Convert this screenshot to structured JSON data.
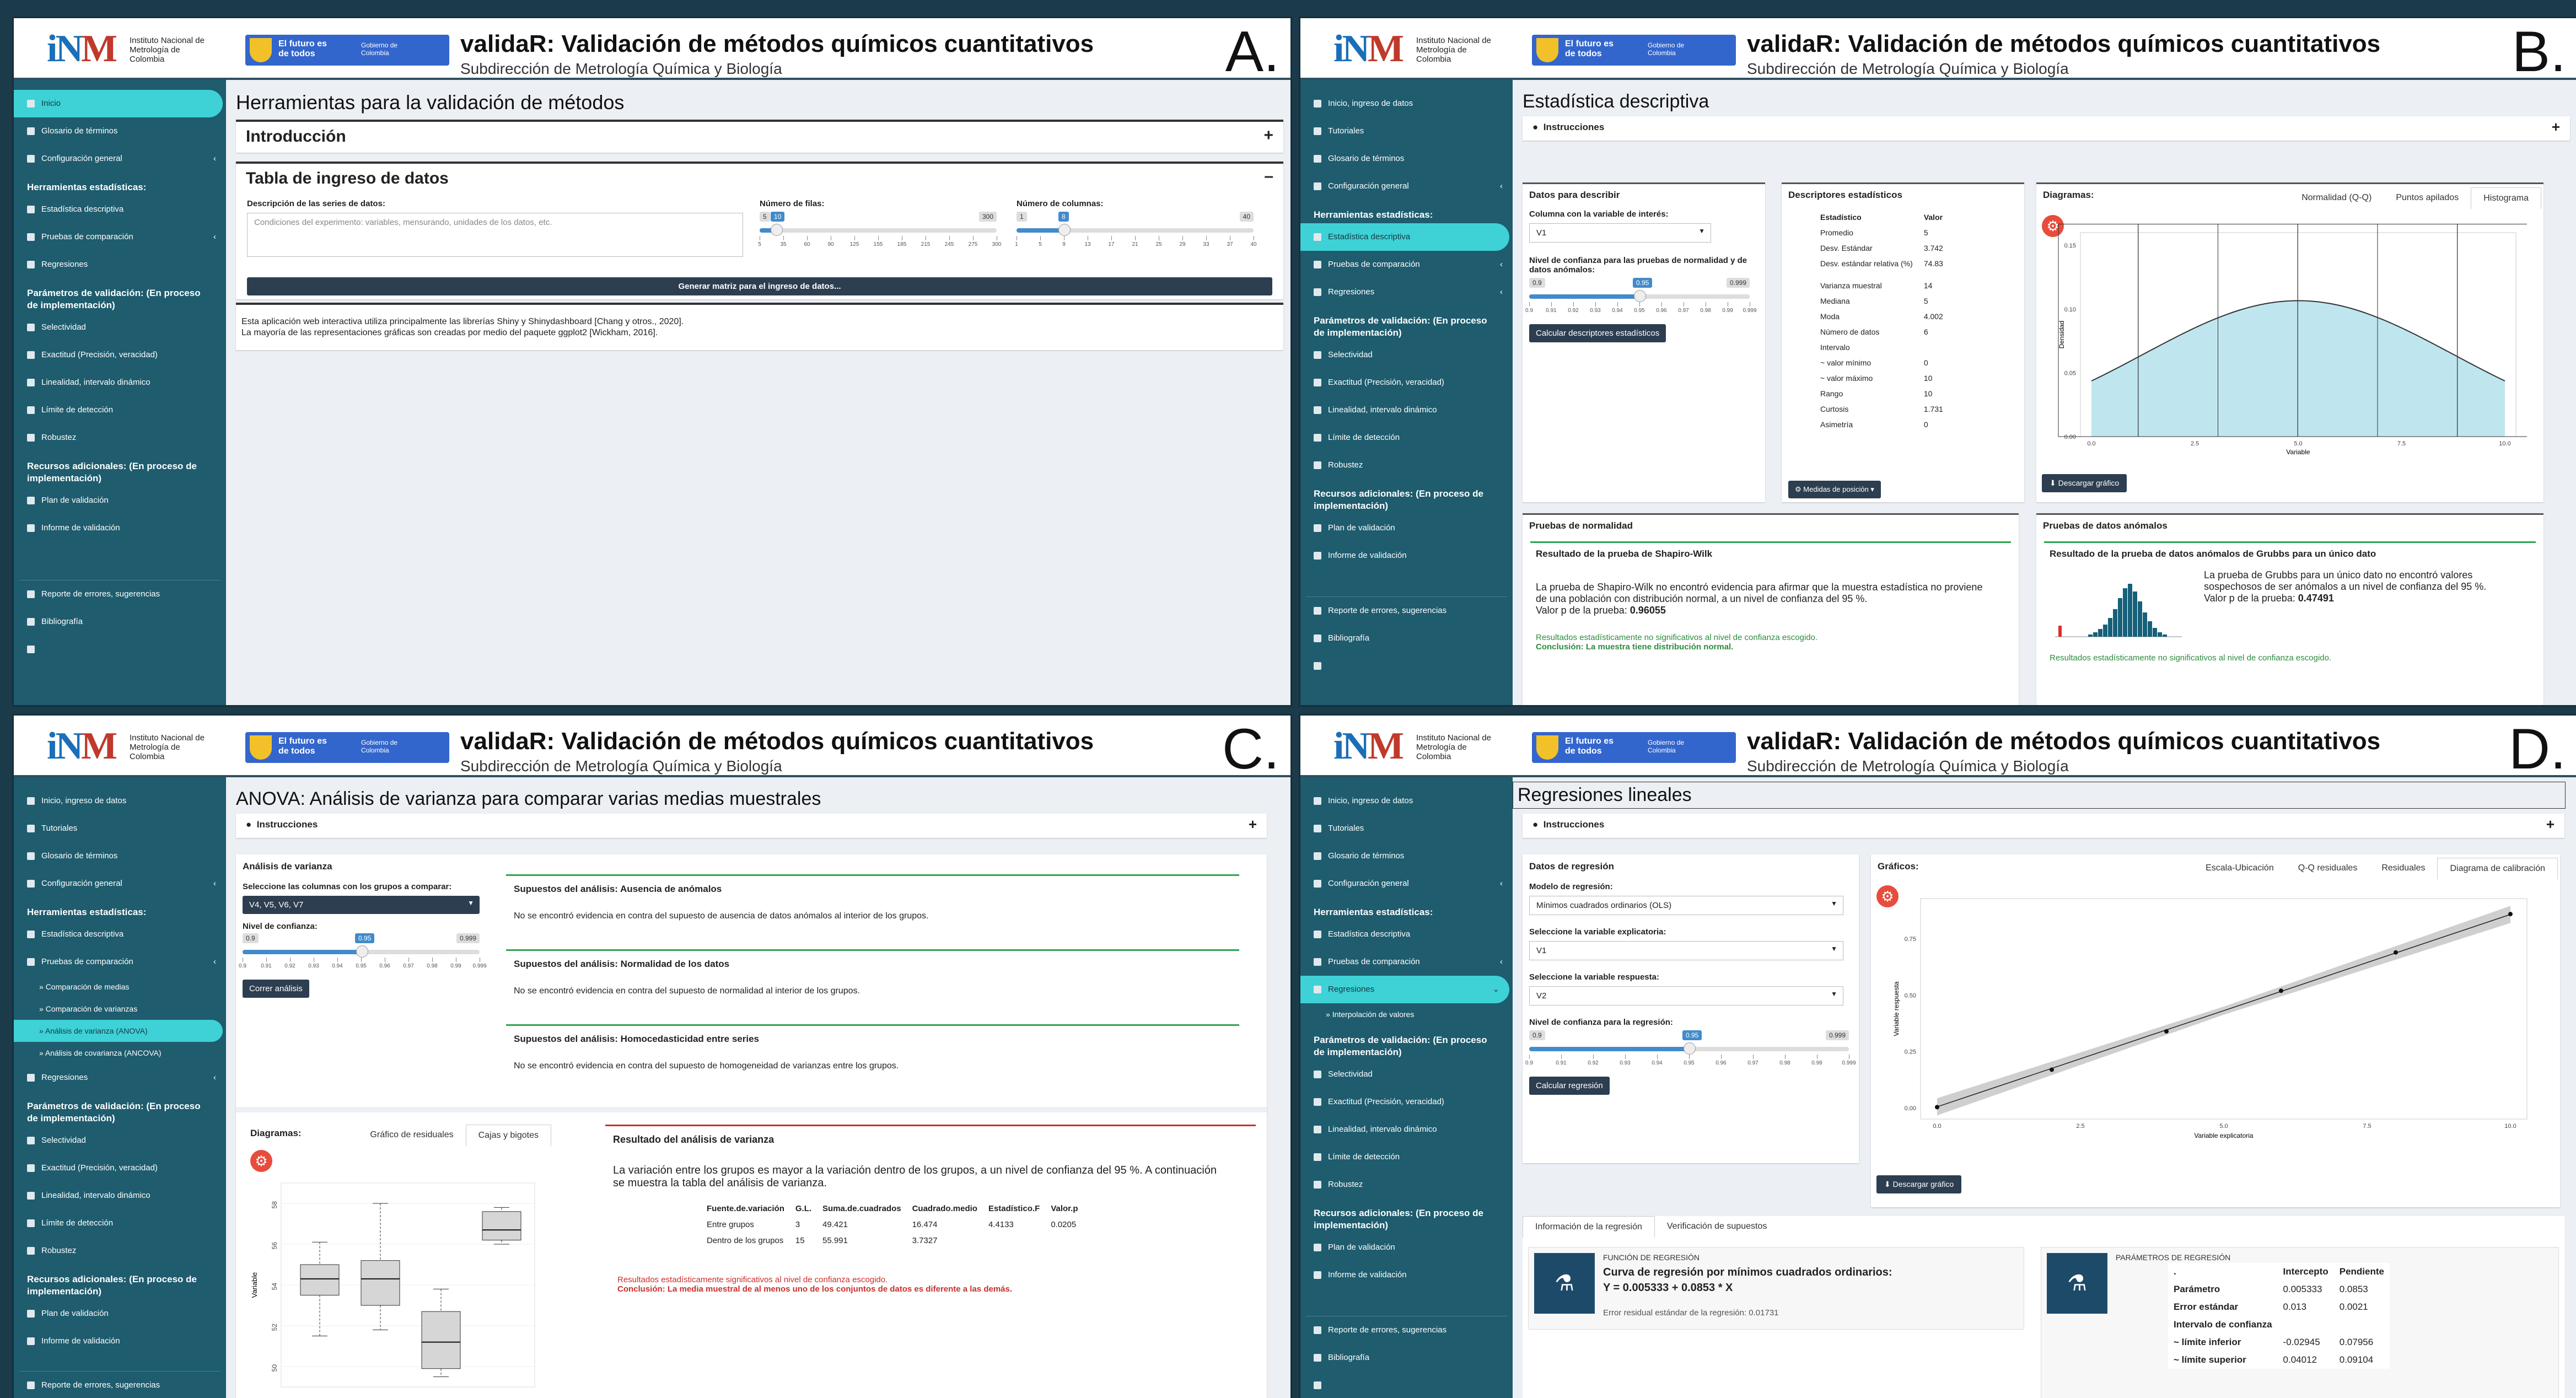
{
  "common": {
    "inm_logo_text": "Instituto Nacional de Metrología de Colombia",
    "gov_t1": "El futuro es de todos",
    "gov_t2": "Gobierno de Colombia",
    "app_title": "validaR: Validación de métodos químicos cuantitativos",
    "app_subtitle": "Subdirección de Metrología Química y Biología"
  },
  "panelA": {
    "letter": "A.",
    "sidebar": [
      {
        "label": "Inicio",
        "active": true
      },
      {
        "label": "Glosario de términos"
      },
      {
        "label": "Configuración general",
        "chev": "‹"
      }
    ],
    "head1": "Herramientas estadísticas:",
    "tools": [
      {
        "label": "Estadística descriptiva"
      },
      {
        "label": "Pruebas de comparación",
        "chev": "‹"
      },
      {
        "label": "Regresiones"
      }
    ],
    "head2": "Parámetros de validación: (En proceso de implementación)",
    "params": [
      {
        "label": "Selectividad"
      },
      {
        "label": "Exactitud (Precisión, veracidad)"
      },
      {
        "label": "Linealidad, intervalo dinámico"
      },
      {
        "label": "Límite de detección"
      },
      {
        "label": "Robustez"
      }
    ],
    "head3": "Recursos adicionales: (En proceso de implementación)",
    "resources": [
      {
        "label": "Plan de validación"
      },
      {
        "label": "Informe de validación"
      }
    ],
    "footer_items": [
      {
        "label": "Reporte de errores, sugerencias"
      },
      {
        "label": "Bibliografía"
      },
      {
        "label": ""
      }
    ],
    "page_title": "Herramientas para la validación de métodos",
    "intro_title": "Introducción",
    "table_title": "Tabla de ingreso de datos",
    "desc_label": "Descripción de las series de datos:",
    "desc_placeholder": "Condiciones del experimento: variables, mensurando, unidades de los datos, etc.",
    "rows_label": "Número de filas:",
    "rows_min": "5",
    "rows_val": "10",
    "rows_max": "300",
    "rows_ticks": [
      "5",
      "35",
      "60",
      "90",
      "125",
      "155",
      "185",
      "215",
      "245",
      "275",
      "300"
    ],
    "cols_label": "Número de columnas:",
    "cols_min": "1",
    "cols_val": "8",
    "cols_max": "40",
    "cols_ticks": [
      "1",
      "5",
      "9",
      "13",
      "17",
      "21",
      "25",
      "29",
      "33",
      "37",
      "40"
    ],
    "gen_button": "Generar matriz para el ingreso de datos...",
    "credits_1": "Esta aplicación web interactiva utiliza principalmente las librerías Shiny y Shinydashboard [Chang y otros., 2020].",
    "credits_2": "La mayoría de las representaciones gráficas son creadas por medio del paquete ggplot2 [Wickham, 2016]."
  },
  "panelB": {
    "letter": "B.",
    "sidebar_top": [
      {
        "label": "Inicio, ingreso de datos"
      },
      {
        "label": "Tutoriales"
      },
      {
        "label": "Glosario de términos"
      },
      {
        "label": "Configuración general",
        "chev": "‹"
      }
    ],
    "tools": [
      {
        "label": "Estadística descriptiva",
        "active": true
      },
      {
        "label": "Pruebas de comparación",
        "chev": "‹"
      },
      {
        "label": "Regresiones",
        "chev": "‹"
      }
    ],
    "page_title": "Estadística descriptiva",
    "instr": "Instrucciones",
    "data_box_title": "Datos para describir",
    "col_label": "Columna con la variable de interés:",
    "col_value": "V1",
    "conf_label": "Nivel de confianza para las pruebas de normalidad y de datos anómalos:",
    "conf_min": "0.9",
    "conf_val": "0.95",
    "conf_max": "0.999",
    "conf_ticks": [
      "0.9",
      "0.91",
      "0.92",
      "0.93",
      "0.94",
      "0.95",
      "0.96",
      "0.97",
      "0.98",
      "0.99",
      "0.999"
    ],
    "calc_button": "Calcular descriptores estadísticos",
    "desc_box_title": "Descriptores estadísticos",
    "desc_head": [
      "Estadístico",
      "Valor"
    ],
    "desc_rows": [
      [
        "Promedio",
        "5"
      ],
      [
        "Desv. Estándar",
        "3.742"
      ],
      [
        "Desv. estándar relativa (%)",
        "74.83"
      ],
      [
        "",
        ""
      ],
      [
        "Varianza muestral",
        "14"
      ],
      [
        "Mediana",
        "5"
      ],
      [
        "Moda",
        "4.002"
      ],
      [
        "Número de datos",
        "6"
      ],
      [
        "Intervalo",
        ""
      ],
      [
        "~ valor mínimo",
        "0"
      ],
      [
        "~ valor máximo",
        "10"
      ],
      [
        "Rango",
        "10"
      ],
      [
        "Curtosis",
        "1.731"
      ],
      [
        "Asimetría",
        "0"
      ]
    ],
    "measures_btn": "Medidas de posición",
    "diag_title": "Diagramas:",
    "diag_tabs": [
      "Normalidad (Q-Q)",
      "Puntos apilados",
      "Histograma"
    ],
    "yaxis_label": "Densidad",
    "xaxis_label": "Variable",
    "hist_y_ticks": [
      "0.00",
      "0.05",
      "0.10",
      "0.15"
    ],
    "hist_x_ticks": [
      "0.0",
      "2.5",
      "5.0",
      "7.5",
      "10.0"
    ],
    "download_btn": "Descargar gráfico",
    "norm_title": "Pruebas de normalidad",
    "sw_title": "Resultado de la prueba de Shapiro-Wilk",
    "sw_text": "La prueba de Shapiro-Wilk no encontró evidencia para afirmar que la muestra estadística no proviene de una población con distribución normal, a un nivel de confianza del 95 %.",
    "sw_p_label": "Valor p de la prueba:",
    "sw_p": "0.96055",
    "sw_green": "Resultados estadísticamente no significativos al nivel de confianza escogido.",
    "sw_concl": "Conclusión: La muestra tiene distribución normal.",
    "outlier_title": "Pruebas de datos anómalos",
    "grubbs_title": "Resultado de la prueba de datos anómalos de Grubbs para un único dato",
    "grubbs_text": "La prueba de Grubbs para un único dato no encontró valores sospechosos de ser anómalos a un nivel de confianza del 95 %.",
    "grubbs_p_label": "Valor p de la prueba:",
    "grubbs_p": "0.47491",
    "grubbs_green": "Resultados estadísticamente no significativos al nivel de confianza escogido."
  },
  "panelC": {
    "letter": "C.",
    "comp_sub": [
      {
        "label": "Comparación de medias"
      },
      {
        "label": "Comparación de varianzas"
      },
      {
        "label": "Análisis de varianza (ANOVA)",
        "active": true
      },
      {
        "label": "Análisis de covarianza (ANCOVA)"
      }
    ],
    "page_title": "ANOVA: Análisis de varianza para comparar varias medias muestrales",
    "box_title": "Análisis de varianza",
    "cols_label": "Seleccione las columnas con los grupos a comparar:",
    "cols_value": "V4, V5, V6, V7",
    "conf_label": "Nivel de confianza:",
    "run_button": "Correr análisis",
    "sup1_title": "Supuestos del análisis: Ausencia de anómalos",
    "sup1_text": "No se encontró evidencia en contra del supuesto de ausencia de datos anómalos al interior de los grupos.",
    "sup2_title": "Supuestos del análisis: Normalidad de los datos",
    "sup2_text": "No se encontró evidencia en contra del supuesto de normalidad al interior de los grupos.",
    "sup3_title": "Supuestos del análisis: Homocedasticidad entre series",
    "sup3_text": "No se encontró evidencia en contra del supuesto de homogeneidad de varianzas entre los grupos.",
    "diag_title": "Diagramas:",
    "diag_tabs": [
      "Gráfico de residuales",
      "Cajas y bigotes"
    ],
    "box_y_ticks": [
      "50",
      "52",
      "54",
      "56",
      "58"
    ],
    "box_ylabel": "Variable",
    "res_title": "Resultado del análisis de varianza",
    "res_text": "La variación entre los grupos es mayor a la variación dentro de los grupos, a un nivel de confianza del 95 %. A continuación se muestra la tabla del análisis de varianza.",
    "anova_head": [
      "Fuente.de.variación",
      "G.L.",
      "Suma.de.cuadrados",
      "Cuadrado.medio",
      "Estadístico.F",
      "Valor.p"
    ],
    "anova_rows": [
      [
        "Entre grupos",
        "3",
        "49.421",
        "16.474",
        "4.4133",
        "0.0205"
      ],
      [
        "Dentro de los grupos",
        "15",
        "55.991",
        "3.7327",
        "",
        ""
      ]
    ],
    "red1": "Resultados estadísticamente significativos al nivel de confianza escogido.",
    "red2": "Conclusión: La media muestral de al menos uno de los conjuntos de datos es diferente a las demás."
  },
  "panelD": {
    "letter": "D.",
    "reg_sub": [
      {
        "label": "Interpolación de valores"
      }
    ],
    "page_title": "Regresiones lineales",
    "box_title": "Datos de regresión",
    "model_label": "Modelo de regresión:",
    "model_value": "Mínimos cuadrados ordinarios (OLS)",
    "x_label": "Seleccione la variable explicatoria:",
    "x_value": "V1",
    "y_label": "Seleccione la variable respuesta:",
    "y_value": "V2",
    "conf_label": "Nivel de confianza para la regresión:",
    "calc_button": "Calcular regresión",
    "graphs_title": "Gráficos:",
    "graph_tabs": [
      "Escala-Ubicación",
      "Q-Q residuales",
      "Residuales",
      "Diagrama de calibración"
    ],
    "cal_xlabel": "Variable explicatoria",
    "cal_ylabel": "Variable respuesta",
    "cal_x_ticks": [
      "0.0",
      "2.5",
      "5.0",
      "7.5",
      "10.0"
    ],
    "cal_y_ticks": [
      "0.00",
      "0.25",
      "0.50",
      "0.75"
    ],
    "info_tabs": [
      "Información de la regresión",
      "Verificación de supuestos"
    ],
    "func_caption": "FUNCIÓN DE REGRESIÓN",
    "func_title": "Curva de regresión por mínimos cuadrados ordinarios:",
    "func_eq": "Y = 0.005333 + 0.0853 * X",
    "func_err": "Error residual estándar de la regresión: 0.01731",
    "param_caption": "PARÁMETROS DE REGRESIÓN",
    "param_head": [
      ".",
      "Intercepto",
      "Pendiente"
    ],
    "param_rows": [
      [
        "Parámetro",
        "0.005333",
        "0.0853"
      ],
      [
        "Error estándar",
        "0.013",
        "0.0021"
      ],
      [
        "Intervalo de confianza",
        "",
        ""
      ],
      [
        "~ límite inferior",
        "-0.02945",
        "0.07956"
      ],
      [
        "~ límite superior",
        "0.04012",
        "0.09104"
      ]
    ]
  },
  "chart_data": [
    {
      "type": "area",
      "ylabel": "Densidad",
      "xlabel": "Variable",
      "x_ticks": [
        0,
        2.5,
        5,
        7.5,
        10
      ],
      "y_ticks": [
        0,
        0.05,
        0.1,
        0.15
      ],
      "histogram_bars": 6
    },
    {
      "type": "box",
      "ylabel": "Variable",
      "y_ticks": [
        50,
        52,
        54,
        56,
        58
      ],
      "groups": [
        {
          "q1": 53.5,
          "median": 54.3,
          "q3": 55.0,
          "min": 51.5,
          "max": 56.1
        },
        {
          "q1": 53.0,
          "median": 54.3,
          "q3": 55.2,
          "min": 51.8,
          "max": 58.0
        },
        {
          "q1": 49.9,
          "median": 51.2,
          "q3": 52.7,
          "min": 49.5,
          "max": 53.8
        },
        {
          "q1": 56.2,
          "median": 56.7,
          "q3": 57.6,
          "min": 56.0,
          "max": 57.8
        }
      ]
    },
    {
      "type": "scatter",
      "xlabel": "Variable explicatoria",
      "ylabel": "Variable respuesta",
      "x": [
        0,
        2,
        4,
        6,
        8,
        10
      ],
      "y": [
        0.004,
        0.17,
        0.34,
        0.52,
        0.69,
        0.86
      ],
      "fit": {
        "intercept": 0.005333,
        "slope": 0.0853
      }
    }
  ]
}
